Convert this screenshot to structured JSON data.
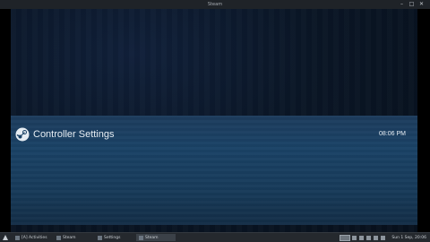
{
  "window": {
    "title": "Steam"
  },
  "app": {
    "page_title": "Controller Settings",
    "clock": "08:06 PM"
  },
  "taskbar": {
    "tasks": [
      {
        "label": "[A] Activities"
      },
      {
        "label": "Steam"
      },
      {
        "label": "Settings"
      },
      {
        "label": "Steam"
      }
    ],
    "datetime": "Sun 1 Sep, 20:06"
  }
}
